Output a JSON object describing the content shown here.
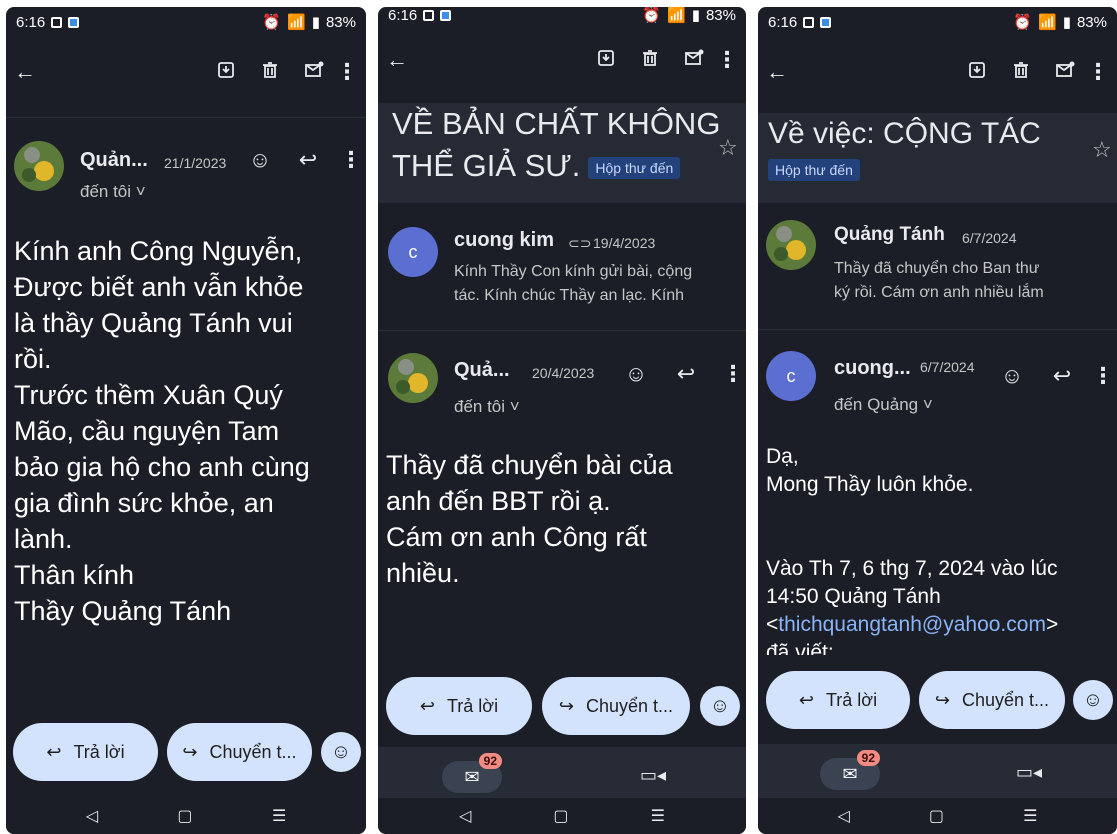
{
  "phone1": {
    "status": {
      "time": "6:16",
      "battery": "83%"
    },
    "message": {
      "sender": "Quản...",
      "date": "21/1/2023",
      "to": "đến tôi ˅"
    },
    "body_lines": [
      "Kính anh Công Nguyễn,",
      "Được biết anh vẫn khỏe",
      "là thầy Quảng Tánh vui",
      "rồi.",
      "Trước thềm Xuân Quý",
      "Mão, cầu nguyện Tam",
      "bảo gia hộ cho anh cùng",
      "gia đình sức khỏe, an",
      "lành.",
      "Thân kính",
      "Thầy Quảng Tánh"
    ],
    "reply_label": "Trả lời",
    "forward_label": "Chuyển t..."
  },
  "phone2": {
    "status": {
      "time": "6:16",
      "battery": "83%"
    },
    "subject_line1": "VỀ BẢN CHẤT KHÔNG",
    "subject_line2": "THỂ GIẢ SƯ.",
    "inbox_chip": "Hộp thư đến",
    "msg1": {
      "avatar_letter": "c",
      "sender": "cuong kim",
      "date": "19/4/2023",
      "snippet_line1": "Kính Thầy Con kính gửi bài, cộng",
      "snippet_line2": "tác. Kính chúc Thầy an lạc. Kính"
    },
    "msg2": {
      "sender": "Quả...",
      "date": "20/4/2023",
      "to": "đến tôi ˅"
    },
    "body_lines": [
      "Thầy đã chuyển bài của",
      "anh đến BBT rồi ạ.",
      "Cám ơn anh Công rất",
      "nhiều."
    ],
    "reply_label": "Trả lời",
    "forward_label": "Chuyển t...",
    "mail_badge": "92"
  },
  "phone3": {
    "status": {
      "time": "6:16",
      "battery": "83%"
    },
    "subject": "Về việc: CỘNG TÁC",
    "inbox_chip": "Hộp thư đến",
    "msg1": {
      "sender": "Quảng Tánh",
      "date": "6/7/2024",
      "snippet_line1": "Thầy đã chuyển cho Ban thư",
      "snippet_line2": "ký rồi. Cám ơn anh nhiều lắm"
    },
    "msg2": {
      "avatar_letter": "c",
      "sender": "cuong...",
      "date": "6/7/2024",
      "to": "đến Quảng ˅"
    },
    "body_lines": [
      "Dạ,",
      "Mong Thầy luôn khỏe.",
      "",
      "",
      "Vào Th 7, 6 thg 7, 2024 vào lúc",
      "14:50 Quảng Tánh"
    ],
    "quote_prefix": "<",
    "quote_email": "thichquangtanh@yahoo.com",
    "quote_suffix": ">",
    "quote_tail": "đã viết:",
    "reply_label": "Trả lời",
    "forward_label": "Chuyển t...",
    "mail_badge": "92"
  }
}
